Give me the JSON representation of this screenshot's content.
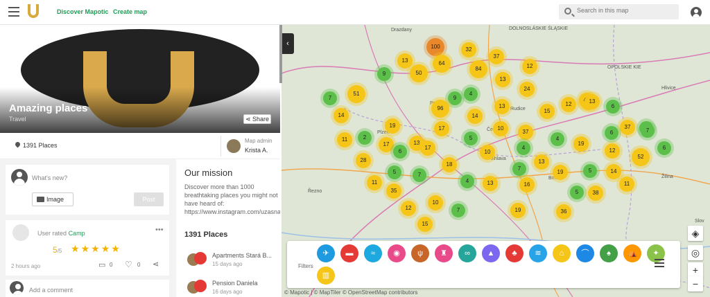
{
  "header": {
    "nav": [
      "Discover Mapotic",
      "Create map"
    ],
    "search_placeholder": "Search in this map"
  },
  "map_profile": {
    "title": "Amazing places",
    "category": "Travel",
    "share_label": "Share",
    "places_count": "1391 Places",
    "admin_label": "Map admin",
    "admin_name": "Krista A."
  },
  "post_box": {
    "placeholder": "What's new?",
    "image_label": "Image",
    "post_label": "Post"
  },
  "activity": {
    "user": "User",
    "action": "rated",
    "target": "Camp",
    "rating": "5",
    "rating_max": "/5",
    "stars": 5,
    "time": "2 hours ago",
    "comments": "0",
    "likes": "0",
    "comment_placeholder": "Add a comment"
  },
  "mission": {
    "title": "Our mission",
    "text": "Discover more than 1000 breathtaking places you might not have heard of: https://www.instagram.com/uzasna"
  },
  "places": {
    "title": "1391 Places",
    "items": [
      {
        "name": "Apartments Stará B...",
        "date": "15 days ago"
      },
      {
        "name": "Pension Daniela",
        "date": "16 days ago"
      }
    ]
  },
  "map": {
    "labels": [
      "Drazdany",
      "DOLNOSLÁSKIE ŚLĄSKIE",
      "OPOLSKIE KIE",
      "Hlivice",
      "Řezno",
      "Žilina",
      "Slov",
      "Jihlava",
      "Plzeň",
      "Praha",
      "Brno",
      "Rudice",
      "Čes"
    ],
    "clusters": [
      {
        "v": "100",
        "c": "#e8882a"
      },
      {
        "v": "32",
        "c": "#f5c518"
      },
      {
        "v": "37",
        "c": "#f5c518"
      },
      {
        "v": "13",
        "c": "#f5c518"
      },
      {
        "v": "64",
        "c": "#f5c518"
      },
      {
        "v": "84",
        "c": "#f5c518"
      },
      {
        "v": "12",
        "c": "#f5c518"
      },
      {
        "v": "50",
        "c": "#f5c518"
      },
      {
        "v": "9",
        "c": "#5cbf4a"
      },
      {
        "v": "51",
        "c": "#f5c518"
      },
      {
        "v": "7",
        "c": "#5cbf4a"
      },
      {
        "v": "13",
        "c": "#f5c518"
      },
      {
        "v": "24",
        "c": "#f5c518"
      },
      {
        "v": "4",
        "c": "#5cbf4a"
      },
      {
        "v": "9",
        "c": "#5cbf4a"
      },
      {
        "v": "96",
        "c": "#f5c518"
      },
      {
        "v": "14",
        "c": "#f5c518"
      },
      {
        "v": "13",
        "c": "#f5c518"
      },
      {
        "v": "12",
        "c": "#f5c518"
      },
      {
        "v": "44",
        "c": "#f5c518"
      },
      {
        "v": "6",
        "c": "#5cbf4a"
      },
      {
        "v": "14",
        "c": "#f5c518"
      },
      {
        "v": "15",
        "c": "#f5c518"
      },
      {
        "v": "14",
        "c": "#f5c518"
      },
      {
        "v": "19",
        "c": "#f5c518"
      },
      {
        "v": "37",
        "c": "#f5c518"
      },
      {
        "v": "17",
        "c": "#f5c518"
      },
      {
        "v": "10",
        "c": "#f5c518"
      },
      {
        "v": "37",
        "c": "#f5c518"
      },
      {
        "v": "13",
        "c": "#f5c518"
      },
      {
        "v": "7",
        "c": "#5cbf4a"
      },
      {
        "v": "11",
        "c": "#f5c518"
      },
      {
        "v": "2",
        "c": "#5cbf4a"
      },
      {
        "v": "17",
        "c": "#f5c518"
      },
      {
        "v": "5",
        "c": "#5cbf4a"
      },
      {
        "v": "4",
        "c": "#5cbf4a"
      },
      {
        "v": "19",
        "c": "#f5c518"
      },
      {
        "v": "12",
        "c": "#f5c518"
      },
      {
        "v": "6",
        "c": "#5cbf4a"
      },
      {
        "v": "17",
        "c": "#f5c518"
      },
      {
        "v": "10",
        "c": "#f5c518"
      },
      {
        "v": "4",
        "c": "#5cbf4a"
      },
      {
        "v": "52",
        "c": "#f5c518"
      },
      {
        "v": "28",
        "c": "#f5c518"
      },
      {
        "v": "18",
        "c": "#f5c518"
      },
      {
        "v": "7",
        "c": "#5cbf4a"
      },
      {
        "v": "13",
        "c": "#f5c518"
      },
      {
        "v": "19",
        "c": "#f5c518"
      },
      {
        "v": "5",
        "c": "#5cbf4a"
      },
      {
        "v": "14",
        "c": "#f5c518"
      },
      {
        "v": "5",
        "c": "#5cbf4a"
      },
      {
        "v": "7",
        "c": "#5cbf4a"
      },
      {
        "v": "4",
        "c": "#5cbf4a"
      },
      {
        "v": "13",
        "c": "#f5c518"
      },
      {
        "v": "16",
        "c": "#f5c518"
      },
      {
        "v": "11",
        "c": "#f5c518"
      },
      {
        "v": "11",
        "c": "#f5c518"
      },
      {
        "v": "35",
        "c": "#f5c518"
      },
      {
        "v": "5",
        "c": "#5cbf4a"
      },
      {
        "v": "38",
        "c": "#f5c518"
      },
      {
        "v": "12",
        "c": "#f5c518"
      },
      {
        "v": "10",
        "c": "#f5c518"
      },
      {
        "v": "7",
        "c": "#5cbf4a"
      },
      {
        "v": "19",
        "c": "#f5c518"
      },
      {
        "v": "36",
        "c": "#f5c518"
      },
      {
        "v": "15",
        "c": "#f5c518"
      },
      {
        "v": "6",
        "c": "#5cbf4a"
      },
      {
        "v": "13",
        "c": "#f5c518"
      },
      {
        "v": "7",
        "c": "#5cbf4a"
      },
      {
        "v": "6",
        "c": "#5cbf4a"
      }
    ],
    "filters_label": "Filters",
    "filter_icons": [
      {
        "name": "pin-icon",
        "c": "#1e9be0",
        "g": "✈"
      },
      {
        "name": "bed-icon",
        "c": "#e53935",
        "g": "▬"
      },
      {
        "name": "swim-icon",
        "c": "#1ea8e0",
        "g": "≈"
      },
      {
        "name": "camera-icon",
        "c": "#e84a8a",
        "g": "◉"
      },
      {
        "name": "restaurant-icon",
        "c": "#c8662a",
        "g": "ψ"
      },
      {
        "name": "castle-icon",
        "c": "#e84a8a",
        "g": "♜"
      },
      {
        "name": "binoculars-icon",
        "c": "#26a69a",
        "g": "∞"
      },
      {
        "name": "tent-icon",
        "c": "#7b68ee",
        "g": "▲"
      },
      {
        "name": "shirt-icon",
        "c": "#e53935",
        "g": "♣"
      },
      {
        "name": "spa-icon",
        "c": "#29a3e8",
        "g": "≋"
      },
      {
        "name": "camp-icon",
        "c": "#f5c518",
        "g": "⌂"
      },
      {
        "name": "bridge-icon",
        "c": "#1e88e5",
        "g": "⌒"
      },
      {
        "name": "tree-icon",
        "c": "#43a047",
        "g": "♠"
      },
      {
        "name": "circus-icon",
        "c": "#ff9800",
        "g": "⛺"
      },
      {
        "name": "compass-icon",
        "c": "#8bc34a",
        "g": "✦"
      },
      {
        "name": "museum-icon",
        "c": "#f5c518",
        "g": "▥"
      }
    ],
    "zoom_in": "+",
    "zoom_out": "−",
    "attribution": "© Mapotic | © MapTiler © OpenStreetMap contributors"
  }
}
